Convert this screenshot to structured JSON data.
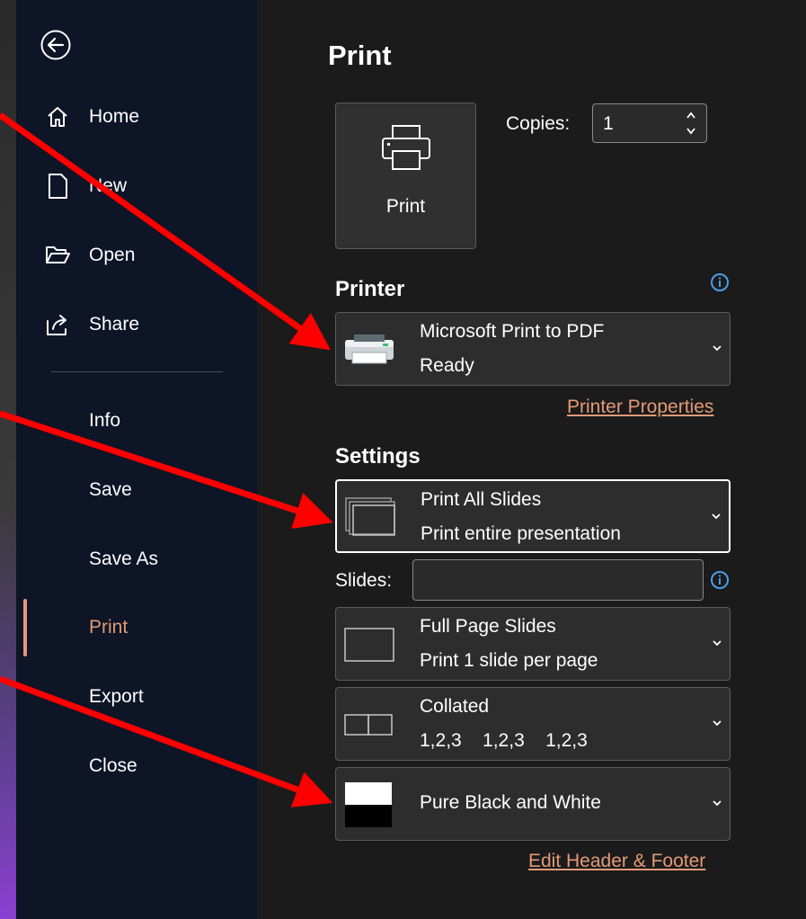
{
  "sidebar": {
    "items": [
      {
        "label": "Home"
      },
      {
        "label": "New"
      },
      {
        "label": "Open"
      },
      {
        "label": "Share"
      },
      {
        "label": "Info"
      },
      {
        "label": "Save"
      },
      {
        "label": "Save As"
      },
      {
        "label": "Print"
      },
      {
        "label": "Export"
      },
      {
        "label": "Close"
      }
    ],
    "active": "Print"
  },
  "main": {
    "title": "Print",
    "print_button": "Print",
    "copies_label": "Copies:",
    "copies_value": "1",
    "printer_section": "Printer",
    "printer": {
      "name": "Microsoft Print to PDF",
      "status": "Ready"
    },
    "printer_properties_link": "Printer Properties",
    "settings_section": "Settings",
    "settings": {
      "range": {
        "title": "Print All Slides",
        "subtitle": "Print entire presentation"
      },
      "slides_label": "Slides:",
      "slides_value": "",
      "layout": {
        "title": "Full Page Slides",
        "subtitle": "Print 1 slide per page"
      },
      "collation": {
        "title": "Collated",
        "subtitle": "1,2,3    1,2,3    1,2,3"
      },
      "color": {
        "title": "Pure Black and White"
      }
    },
    "edit_header_footer_link": "Edit Header & Footer"
  },
  "colors": {
    "accent": "#e39a76",
    "sidebar_bg": "#0d1526",
    "main_bg": "#1b1b1b",
    "annotation_arrow": "#ff0000",
    "info_icon": "#4a9fe8"
  },
  "icons": [
    "back-arrow-icon",
    "home-icon",
    "new-document-icon",
    "folder-open-icon",
    "share-icon",
    "printer-icon",
    "info-icon",
    "chevron-down-icon"
  ]
}
